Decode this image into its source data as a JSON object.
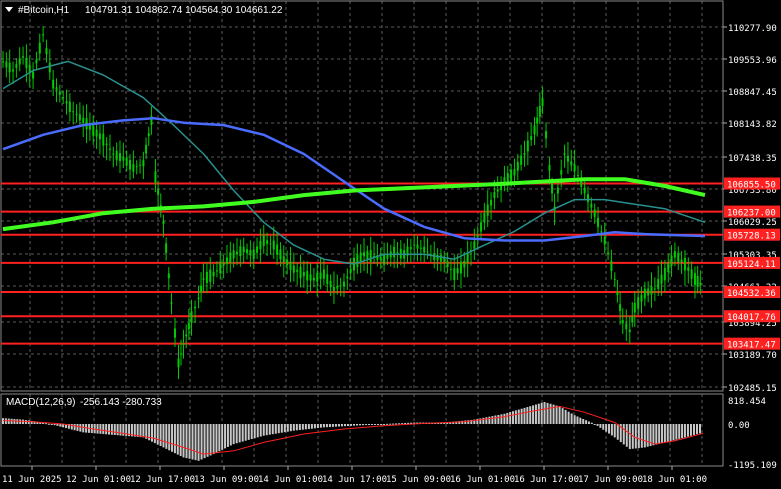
{
  "header": {
    "symbol_title": "#Bitcoin,H1",
    "ohlc": "104791.31 104862.74 104564.30 104661.22"
  },
  "colors": {
    "background": "#000000",
    "grid": "#5a5a5a",
    "axis_text": "#ffffff",
    "candle": "#00cc00",
    "ma_fast": "#2a8f8f",
    "ma_mid": "#4a6cff",
    "ma_slow": "#40ff20",
    "level_line": "#ff2020",
    "macd_hist": "#c8c8c8",
    "macd_signal": "#ff2020"
  },
  "chart_data": [
    {
      "type": "line",
      "name": "price",
      "ylim": [
        102485.15,
        110450
      ],
      "x_tick_labels": [
        "11 Jun 2025",
        "12 Jun 01:00",
        "12 Jun 17:00",
        "13 Jun 09:00",
        "14 Jun 01:00",
        "14 Jun 17:00",
        "15 Jun 09:00",
        "16 Jun 01:00",
        "16 Jun 17:00",
        "17 Jun 09:00",
        "18 Jun 01:00"
      ],
      "y_tick_labels": [
        "110277.90",
        "109553.96",
        "108847.45",
        "108143.82",
        "107438.35",
        "106733.80",
        "106029.25",
        "105303.35",
        "104661.22",
        "103894.25",
        "103189.70",
        "102485.15"
      ],
      "y_tick_values": [
        110277.9,
        109553.96,
        108847.45,
        108143.82,
        107438.35,
        106733.8,
        106029.25,
        105303.35,
        104661.22,
        103894.25,
        103189.7,
        102485.15
      ],
      "levels": [
        {
          "label": "106855.50",
          "value": 106855.5
        },
        {
          "label": "106237.00",
          "value": 106237.0
        },
        {
          "label": "105728.13",
          "value": 105728.13
        },
        {
          "label": "105124.11",
          "value": 105124.11
        },
        {
          "label": "104532.36",
          "value": 104532.36
        },
        {
          "label": "104017.76",
          "value": 104017.76
        },
        {
          "label": "103417.47",
          "value": 103417.47
        }
      ],
      "price_series": [
        [
          0,
          109500
        ],
        [
          10,
          109300
        ],
        [
          20,
          109600
        ],
        [
          30,
          109200
        ],
        [
          40,
          110100
        ],
        [
          50,
          109000
        ],
        [
          60,
          108700
        ],
        [
          70,
          108400
        ],
        [
          80,
          108200
        ],
        [
          90,
          108000
        ],
        [
          100,
          107800
        ],
        [
          110,
          107500
        ],
        [
          120,
          107400
        ],
        [
          130,
          107200
        ],
        [
          140,
          107300
        ],
        [
          148,
          108200
        ],
        [
          152,
          107000
        ],
        [
          160,
          106000
        ],
        [
          168,
          104300
        ],
        [
          175,
          103000
        ],
        [
          180,
          103400
        ],
        [
          188,
          104000
        ],
        [
          195,
          104400
        ],
        [
          200,
          104800
        ],
        [
          210,
          104900
        ],
        [
          220,
          105100
        ],
        [
          230,
          105300
        ],
        [
          240,
          105400
        ],
        [
          250,
          105300
        ],
        [
          260,
          105600
        ],
        [
          270,
          105500
        ],
        [
          280,
          105200
        ],
        [
          290,
          105000
        ],
        [
          300,
          104900
        ],
        [
          310,
          104800
        ],
        [
          320,
          104900
        ],
        [
          330,
          104600
        ],
        [
          340,
          104700
        ],
        [
          350,
          105100
        ],
        [
          360,
          105300
        ],
        [
          370,
          105250
        ],
        [
          380,
          105200
        ],
        [
          390,
          105350
        ],
        [
          400,
          105300
        ],
        [
          410,
          105500
        ],
        [
          420,
          105400
        ],
        [
          430,
          105250
        ],
        [
          440,
          105200
        ],
        [
          450,
          104900
        ],
        [
          460,
          105100
        ],
        [
          470,
          105500
        ],
        [
          480,
          106100
        ],
        [
          490,
          106600
        ],
        [
          500,
          106900
        ],
        [
          510,
          107100
        ],
        [
          520,
          107500
        ],
        [
          530,
          108000
        ],
        [
          538,
          108600
        ],
        [
          545,
          107200
        ],
        [
          550,
          106300
        ],
        [
          560,
          107500
        ],
        [
          570,
          107200
        ],
        [
          580,
          106700
        ],
        [
          590,
          106200
        ],
        [
          600,
          105600
        ],
        [
          610,
          104800
        ],
        [
          618,
          103900
        ],
        [
          625,
          103700
        ],
        [
          630,
          104200
        ],
        [
          640,
          104500
        ],
        [
          650,
          104600
        ],
        [
          660,
          104900
        ],
        [
          670,
          105300
        ],
        [
          680,
          105100
        ],
        [
          690,
          104800
        ],
        [
          698,
          104661
        ]
      ],
      "ma_fast_series": [
        [
          0,
          108900
        ],
        [
          30,
          109300
        ],
        [
          65,
          109500
        ],
        [
          100,
          109200
        ],
        [
          140,
          108700
        ],
        [
          170,
          108100
        ],
        [
          200,
          107500
        ],
        [
          230,
          106700
        ],
        [
          260,
          106000
        ],
        [
          290,
          105500
        ],
        [
          320,
          105200
        ],
        [
          350,
          105100
        ],
        [
          380,
          105300
        ],
        [
          420,
          105300
        ],
        [
          450,
          105200
        ],
        [
          480,
          105500
        ],
        [
          510,
          105800
        ],
        [
          540,
          106200
        ],
        [
          570,
          106500
        ],
        [
          600,
          106500
        ],
        [
          630,
          106400
        ],
        [
          660,
          106300
        ],
        [
          700,
          106000
        ]
      ],
      "ma_mid_series": [
        [
          0,
          107600
        ],
        [
          40,
          107900
        ],
        [
          80,
          108100
        ],
        [
          120,
          108200
        ],
        [
          150,
          108250
        ],
        [
          180,
          108150
        ],
        [
          220,
          108100
        ],
        [
          260,
          107900
        ],
        [
          300,
          107500
        ],
        [
          340,
          106900
        ],
        [
          380,
          106300
        ],
        [
          420,
          105900
        ],
        [
          460,
          105650
        ],
        [
          500,
          105600
        ],
        [
          540,
          105600
        ],
        [
          580,
          105700
        ],
        [
          610,
          105780
        ],
        [
          640,
          105740
        ],
        [
          670,
          105720
        ],
        [
          700,
          105700
        ]
      ],
      "ma_slow_series": [
        [
          0,
          105850
        ],
        [
          50,
          106000
        ],
        [
          100,
          106200
        ],
        [
          150,
          106300
        ],
        [
          200,
          106350
        ],
        [
          250,
          106450
        ],
        [
          300,
          106600
        ],
        [
          350,
          106700
        ],
        [
          400,
          106750
        ],
        [
          450,
          106800
        ],
        [
          500,
          106850
        ],
        [
          540,
          106900
        ],
        [
          580,
          106950
        ],
        [
          620,
          106950
        ],
        [
          660,
          106800
        ],
        [
          700,
          106600
        ]
      ]
    },
    {
      "type": "bar",
      "name": "MACD(12,26,9)",
      "indicator_label": "MACD(12,26,9)",
      "indicator_values": "-256.143 -280.733",
      "ylim": [
        -1195.109,
        818.454
      ],
      "y_tick_labels": [
        "818.454",
        "0.00",
        "-1195.109"
      ],
      "y_tick_values": [
        818.454,
        0,
        -1195.109
      ],
      "histogram": [
        [
          0,
          200
        ],
        [
          20,
          150
        ],
        [
          40,
          50
        ],
        [
          60,
          -100
        ],
        [
          80,
          -250
        ],
        [
          100,
          -300
        ],
        [
          120,
          -350
        ],
        [
          140,
          -400
        ],
        [
          160,
          -700
        ],
        [
          180,
          -1000
        ],
        [
          195,
          -1100
        ],
        [
          210,
          -900
        ],
        [
          230,
          -600
        ],
        [
          260,
          -350
        ],
        [
          290,
          -200
        ],
        [
          320,
          -100
        ],
        [
          350,
          -50
        ],
        [
          380,
          0
        ],
        [
          410,
          50
        ],
        [
          440,
          50
        ],
        [
          470,
          150
        ],
        [
          500,
          350
        ],
        [
          520,
          550
        ],
        [
          540,
          750
        ],
        [
          555,
          600
        ],
        [
          570,
          300
        ],
        [
          590,
          0
        ],
        [
          610,
          -400
        ],
        [
          625,
          -750
        ],
        [
          640,
          -700
        ],
        [
          660,
          -550
        ],
        [
          680,
          -400
        ],
        [
          698,
          -256
        ]
      ],
      "signal": [
        [
          0,
          120
        ],
        [
          30,
          80
        ],
        [
          60,
          0
        ],
        [
          90,
          -150
        ],
        [
          120,
          -280
        ],
        [
          150,
          -420
        ],
        [
          180,
          -700
        ],
        [
          200,
          -900
        ],
        [
          230,
          -800
        ],
        [
          260,
          -550
        ],
        [
          300,
          -300
        ],
        [
          340,
          -150
        ],
        [
          380,
          -50
        ],
        [
          420,
          20
        ],
        [
          460,
          80
        ],
        [
          500,
          250
        ],
        [
          530,
          450
        ],
        [
          555,
          600
        ],
        [
          580,
          400
        ],
        [
          610,
          50
        ],
        [
          630,
          -400
        ],
        [
          650,
          -600
        ],
        [
          670,
          -500
        ],
        [
          698,
          -280
        ]
      ]
    }
  ]
}
